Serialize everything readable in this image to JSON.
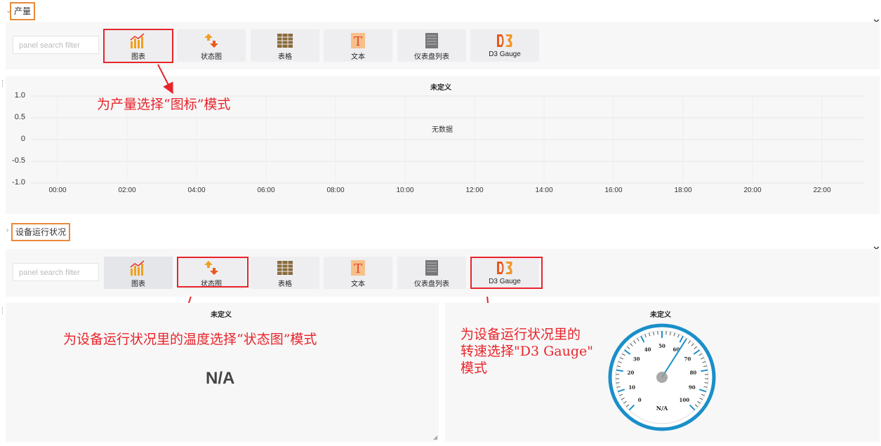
{
  "row1": {
    "title": "产量"
  },
  "row2": {
    "title": "设备运行状况"
  },
  "picker": {
    "filter_placeholder": "panel search filter",
    "types": [
      {
        "label": "图表",
        "icon": "graph-icon"
      },
      {
        "label": "状态图",
        "icon": "singlestat-icon"
      },
      {
        "label": "表格",
        "icon": "table-icon"
      },
      {
        "label": "文本",
        "icon": "text-icon"
      },
      {
        "label": "仪表盘列表",
        "icon": "dashlist-icon"
      },
      {
        "label": "D3 Gauge",
        "icon": "d3-icon"
      }
    ]
  },
  "chart_panel": {
    "title": "未定义",
    "no_data": "无数据",
    "chart_data": {
      "type": "line",
      "series": [],
      "x_ticks": [
        "00:00",
        "02:00",
        "04:00",
        "06:00",
        "08:00",
        "10:00",
        "12:00",
        "14:00",
        "16:00",
        "18:00",
        "20:00",
        "22:00"
      ],
      "y_ticks": [
        "1.0",
        "0.5",
        "0",
        "-0.5",
        "-1.0"
      ],
      "ylim": [
        -1.0,
        1.0
      ],
      "grid": true
    }
  },
  "stat_panel": {
    "title": "未定义",
    "value": "N/A"
  },
  "gauge_panel": {
    "title": "未定义",
    "value_label": "N/A",
    "scale_labels": [
      "0",
      "10",
      "20",
      "30",
      "40",
      "50",
      "60",
      "70",
      "80",
      "90",
      "100"
    ],
    "needle_value": 62
  },
  "annotations": {
    "a1": "为产量选择“图标”模式",
    "a2": "为设备运行状况里的温度选择“状态图”模式",
    "a3_line1": "为设备运行状况里的",
    "a3_line2": "转速选择\"D3 Gauge\"",
    "a3_line3": "模式"
  },
  "colors": {
    "highlight_orange": "#e8893a",
    "annotation_red": "#e8242b",
    "gauge_blue": "#1a8fc9"
  }
}
